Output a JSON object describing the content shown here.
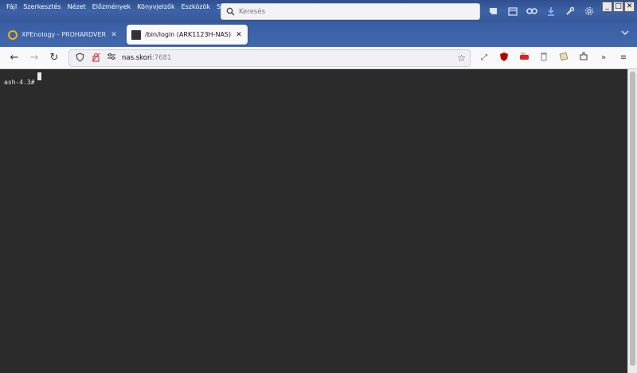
{
  "menu": {
    "items": [
      "Fájl",
      "Szerkesztés",
      "Nézet",
      "Előzmények",
      "Könyvjelzők",
      "Eszközök",
      "Súgó"
    ]
  },
  "search": {
    "placeholder": "Keresés"
  },
  "window_controls": {
    "minimize": "_",
    "maximize": "□",
    "close": "✕"
  },
  "tabs": [
    {
      "label": "XPEnology - PROHARDVER! Hozzá",
      "favicon_color": "#f5b400",
      "active": false
    },
    {
      "label": "/bin/login (ARK1123H-NAS)",
      "favicon_color": "#333333",
      "active": true
    }
  ],
  "urlbar": {
    "host": "nas.skori",
    "port": ":7681"
  },
  "terminal": {
    "prompt": "ash-4.3#"
  },
  "colors": {
    "terminal_bg": "#2b2b2b",
    "chrome_blue": "#3d62a8",
    "active_tab": "#f9f9fb"
  }
}
